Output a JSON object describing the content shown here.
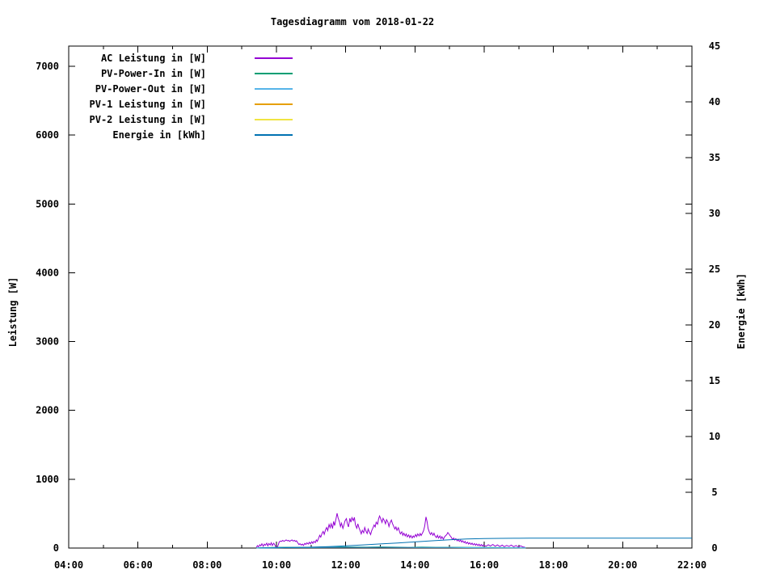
{
  "title": "Tagesdiagramm vom 2018-01-22",
  "chart_data": {
    "type": "line",
    "title": "Tagesdiagramm vom 2018-01-22",
    "grid": false,
    "background": "#ffffff",
    "legend_position": "top-left-inside",
    "x_axis": {
      "unit": "time",
      "range_hours": [
        4,
        22
      ],
      "minor_tick_every_hours": 1,
      "ticks": [
        {
          "h": 4,
          "label": "04:00"
        },
        {
          "h": 6,
          "label": "06:00"
        },
        {
          "h": 8,
          "label": "08:00"
        },
        {
          "h": 10,
          "label": "10:00"
        },
        {
          "h": 12,
          "label": "12:00"
        },
        {
          "h": 14,
          "label": "14:00"
        },
        {
          "h": 16,
          "label": "16:00"
        },
        {
          "h": 18,
          "label": "18:00"
        },
        {
          "h": 20,
          "label": "20:00"
        },
        {
          "h": 22,
          "label": "22:00"
        }
      ]
    },
    "y_axis_left": {
      "label": "Leistung [W]",
      "range": [
        0,
        7294
      ],
      "ticks": [
        0,
        1000,
        2000,
        3000,
        4000,
        5000,
        6000,
        7000
      ]
    },
    "y_axis_right": {
      "label": "Energie [kWh]",
      "range": [
        0,
        45
      ],
      "ticks": [
        0,
        5,
        10,
        15,
        20,
        25,
        30,
        35,
        40,
        45
      ]
    },
    "series": [
      {
        "name": "ac-leistung",
        "legend_label": "AC Leistung in [W]",
        "color": "#9400d3",
        "axis": "left",
        "points": [
          [
            9.42,
            8
          ],
          [
            9.45,
            35
          ],
          [
            9.48,
            18
          ],
          [
            9.52,
            48
          ],
          [
            9.55,
            30
          ],
          [
            9.58,
            62
          ],
          [
            9.62,
            25
          ],
          [
            9.65,
            58
          ],
          [
            9.68,
            40
          ],
          [
            9.72,
            70
          ],
          [
            9.75,
            32
          ],
          [
            9.78,
            66
          ],
          [
            9.82,
            45
          ],
          [
            9.85,
            78
          ],
          [
            9.88,
            36
          ],
          [
            9.92,
            70
          ],
          [
            9.95,
            48
          ],
          [
            9.98,
            20
          ],
          [
            10.02,
            12
          ],
          [
            10.05,
            42
          ],
          [
            10.08,
            88
          ],
          [
            10.12,
            102
          ],
          [
            10.15,
            96
          ],
          [
            10.18,
            112
          ],
          [
            10.22,
            98
          ],
          [
            10.25,
            108
          ],
          [
            10.28,
            118
          ],
          [
            10.32,
            104
          ],
          [
            10.35,
            112
          ],
          [
            10.38,
            98
          ],
          [
            10.42,
            110
          ],
          [
            10.45,
            118
          ],
          [
            10.48,
            102
          ],
          [
            10.52,
            112
          ],
          [
            10.55,
            96
          ],
          [
            10.58,
            106
          ],
          [
            10.62,
            72
          ],
          [
            10.65,
            50
          ],
          [
            10.68,
            62
          ],
          [
            10.72,
            44
          ],
          [
            10.75,
            58
          ],
          [
            10.78,
            38
          ],
          [
            10.82,
            68
          ],
          [
            10.85,
            52
          ],
          [
            10.88,
            76
          ],
          [
            10.92,
            58
          ],
          [
            10.95,
            84
          ],
          [
            10.98,
            62
          ],
          [
            11.02,
            92
          ],
          [
            11.05,
            68
          ],
          [
            11.08,
            98
          ],
          [
            11.12,
            78
          ],
          [
            11.15,
            118
          ],
          [
            11.18,
            96
          ],
          [
            11.22,
            148
          ],
          [
            11.25,
            186
          ],
          [
            11.28,
            158
          ],
          [
            11.32,
            216
          ],
          [
            11.35,
            242
          ],
          [
            11.38,
            198
          ],
          [
            11.42,
            268
          ],
          [
            11.45,
            298
          ],
          [
            11.48,
            252
          ],
          [
            11.52,
            342
          ],
          [
            11.55,
            296
          ],
          [
            11.58,
            352
          ],
          [
            11.62,
            284
          ],
          [
            11.65,
            386
          ],
          [
            11.68,
            326
          ],
          [
            11.72,
            426
          ],
          [
            11.75,
            505
          ],
          [
            11.78,
            442
          ],
          [
            11.82,
            378
          ],
          [
            11.85,
            312
          ],
          [
            11.88,
            362
          ],
          [
            11.92,
            286
          ],
          [
            11.95,
            336
          ],
          [
            11.98,
            396
          ],
          [
            12.02,
            428
          ],
          [
            12.05,
            352
          ],
          [
            12.08,
            306
          ],
          [
            12.12,
            432
          ],
          [
            12.15,
            376
          ],
          [
            12.18,
            442
          ],
          [
            12.22,
            398
          ],
          [
            12.25,
            446
          ],
          [
            12.28,
            338
          ],
          [
            12.32,
            288
          ],
          [
            12.35,
            352
          ],
          [
            12.38,
            302
          ],
          [
            12.42,
            246
          ],
          [
            12.45,
            206
          ],
          [
            12.48,
            258
          ],
          [
            12.52,
            222
          ],
          [
            12.55,
            298
          ],
          [
            12.58,
            252
          ],
          [
            12.62,
            212
          ],
          [
            12.65,
            276
          ],
          [
            12.68,
            236
          ],
          [
            12.72,
            196
          ],
          [
            12.75,
            252
          ],
          [
            12.78,
            286
          ],
          [
            12.82,
            336
          ],
          [
            12.85,
            306
          ],
          [
            12.88,
            376
          ],
          [
            12.92,
            346
          ],
          [
            12.95,
            428
          ],
          [
            12.98,
            466
          ],
          [
            13.02,
            412
          ],
          [
            13.05,
            372
          ],
          [
            13.08,
            432
          ],
          [
            13.12,
            396
          ],
          [
            13.15,
            352
          ],
          [
            13.18,
            412
          ],
          [
            13.22,
            376
          ],
          [
            13.25,
            312
          ],
          [
            13.28,
            366
          ],
          [
            13.32,
            406
          ],
          [
            13.35,
            356
          ],
          [
            13.38,
            322
          ],
          [
            13.42,
            276
          ],
          [
            13.45,
            306
          ],
          [
            13.48,
            256
          ],
          [
            13.52,
            296
          ],
          [
            13.55,
            246
          ],
          [
            13.58,
            206
          ],
          [
            13.62,
            236
          ],
          [
            13.65,
            186
          ],
          [
            13.68,
            216
          ],
          [
            13.72,
            176
          ],
          [
            13.75,
            206
          ],
          [
            13.78,
            162
          ],
          [
            13.82,
            192
          ],
          [
            13.85,
            152
          ],
          [
            13.88,
            182
          ],
          [
            13.92,
            146
          ],
          [
            13.95,
            176
          ],
          [
            13.98,
            156
          ],
          [
            14.02,
            196
          ],
          [
            14.05,
            166
          ],
          [
            14.08,
            206
          ],
          [
            14.12,
            176
          ],
          [
            14.15,
            212
          ],
          [
            14.18,
            182
          ],
          [
            14.22,
            222
          ],
          [
            14.25,
            252
          ],
          [
            14.28,
            312
          ],
          [
            14.32,
            452
          ],
          [
            14.35,
            386
          ],
          [
            14.38,
            286
          ],
          [
            14.42,
            226
          ],
          [
            14.45,
            196
          ],
          [
            14.48,
            226
          ],
          [
            14.52,
            186
          ],
          [
            14.55,
            216
          ],
          [
            14.58,
            176
          ],
          [
            14.62,
            152
          ],
          [
            14.65,
            186
          ],
          [
            14.68,
            146
          ],
          [
            14.72,
            176
          ],
          [
            14.75,
            136
          ],
          [
            14.78,
            166
          ],
          [
            14.82,
            128
          ],
          [
            14.85,
            158
          ],
          [
            14.88,
            176
          ],
          [
            14.92,
            196
          ],
          [
            14.95,
            226
          ],
          [
            14.98,
            206
          ],
          [
            15.02,
            176
          ],
          [
            15.05,
            156
          ],
          [
            15.08,
            126
          ],
          [
            15.12,
            146
          ],
          [
            15.15,
            116
          ],
          [
            15.18,
            136
          ],
          [
            15.22,
            106
          ],
          [
            15.25,
            126
          ],
          [
            15.28,
            96
          ],
          [
            15.32,
            116
          ],
          [
            15.35,
            86
          ],
          [
            15.38,
            106
          ],
          [
            15.42,
            78
          ],
          [
            15.45,
            96
          ],
          [
            15.48,
            66
          ],
          [
            15.52,
            86
          ],
          [
            15.55,
            58
          ],
          [
            15.58,
            78
          ],
          [
            15.62,
            52
          ],
          [
            15.65,
            72
          ],
          [
            15.68,
            46
          ],
          [
            15.72,
            66
          ],
          [
            15.75,
            40
          ],
          [
            15.78,
            60
          ],
          [
            15.82,
            36
          ],
          [
            15.85,
            56
          ],
          [
            15.88,
            32
          ],
          [
            15.92,
            50
          ],
          [
            15.95,
            28
          ],
          [
            15.98,
            46
          ],
          [
            16.05,
            26
          ],
          [
            16.12,
            48
          ],
          [
            16.18,
            30
          ],
          [
            16.25,
            52
          ],
          [
            16.32,
            26
          ],
          [
            16.38,
            46
          ],
          [
            16.45,
            22
          ],
          [
            16.52,
            42
          ],
          [
            16.58,
            20
          ],
          [
            16.65,
            38
          ],
          [
            16.72,
            24
          ],
          [
            16.78,
            44
          ],
          [
            16.85,
            20
          ],
          [
            16.92,
            36
          ],
          [
            16.98,
            18
          ],
          [
            17.05,
            32
          ],
          [
            17.12,
            16
          ],
          [
            17.18,
            12
          ]
        ]
      },
      {
        "name": "pv-power-in",
        "legend_label": "PV-Power-In in [W]",
        "color": "#009e73",
        "axis": "left",
        "points": [
          [
            9.42,
            2
          ],
          [
            9.7,
            6
          ],
          [
            10.0,
            10
          ],
          [
            10.3,
            12
          ],
          [
            10.7,
            10
          ],
          [
            11.0,
            10
          ],
          [
            11.4,
            14
          ],
          [
            11.8,
            18
          ],
          [
            12.2,
            16
          ],
          [
            12.6,
            14
          ],
          [
            13.0,
            18
          ],
          [
            13.4,
            15
          ],
          [
            13.8,
            12
          ],
          [
            14.2,
            14
          ],
          [
            14.6,
            12
          ],
          [
            15.0,
            12
          ],
          [
            15.4,
            10
          ],
          [
            15.8,
            8
          ],
          [
            16.2,
            8
          ],
          [
            16.6,
            6
          ],
          [
            17.0,
            5
          ],
          [
            17.2,
            3
          ]
        ]
      },
      {
        "name": "pv-power-out",
        "legend_label": "PV-Power-Out in [W]",
        "color": "#56b4e9",
        "axis": "left",
        "points": [
          [
            9.42,
            1
          ],
          [
            10.0,
            6
          ],
          [
            10.5,
            9
          ],
          [
            11.0,
            7
          ],
          [
            11.5,
            10
          ],
          [
            12.0,
            12
          ],
          [
            12.5,
            10
          ],
          [
            13.0,
            12
          ],
          [
            13.5,
            10
          ],
          [
            14.0,
            9
          ],
          [
            14.5,
            9
          ],
          [
            15.0,
            8
          ],
          [
            15.5,
            6
          ],
          [
            16.0,
            5
          ],
          [
            16.5,
            4
          ],
          [
            17.0,
            3
          ],
          [
            17.2,
            2
          ]
        ]
      },
      {
        "name": "pv-1-leistung",
        "legend_label": "PV-1 Leistung in [W]",
        "color": "#e69f00",
        "axis": "left",
        "points": []
      },
      {
        "name": "pv-2-leistung",
        "legend_label": "PV-2 Leistung in [W]",
        "color": "#f0e442",
        "axis": "left",
        "points": []
      },
      {
        "name": "energie",
        "legend_label": "Energie in [kWh]",
        "color": "#0072b2",
        "axis": "right",
        "points": [
          [
            9.5,
            0.0
          ],
          [
            10.0,
            0.02
          ],
          [
            10.5,
            0.05
          ],
          [
            11.0,
            0.08
          ],
          [
            11.5,
            0.13
          ],
          [
            12.0,
            0.2
          ],
          [
            12.5,
            0.28
          ],
          [
            13.0,
            0.37
          ],
          [
            13.5,
            0.46
          ],
          [
            14.0,
            0.55
          ],
          [
            14.5,
            0.65
          ],
          [
            15.0,
            0.74
          ],
          [
            15.5,
            0.81
          ],
          [
            16.0,
            0.85
          ],
          [
            16.5,
            0.87
          ],
          [
            17.0,
            0.88
          ],
          [
            17.3,
            0.89
          ],
          [
            22.0,
            0.89
          ]
        ]
      }
    ]
  }
}
